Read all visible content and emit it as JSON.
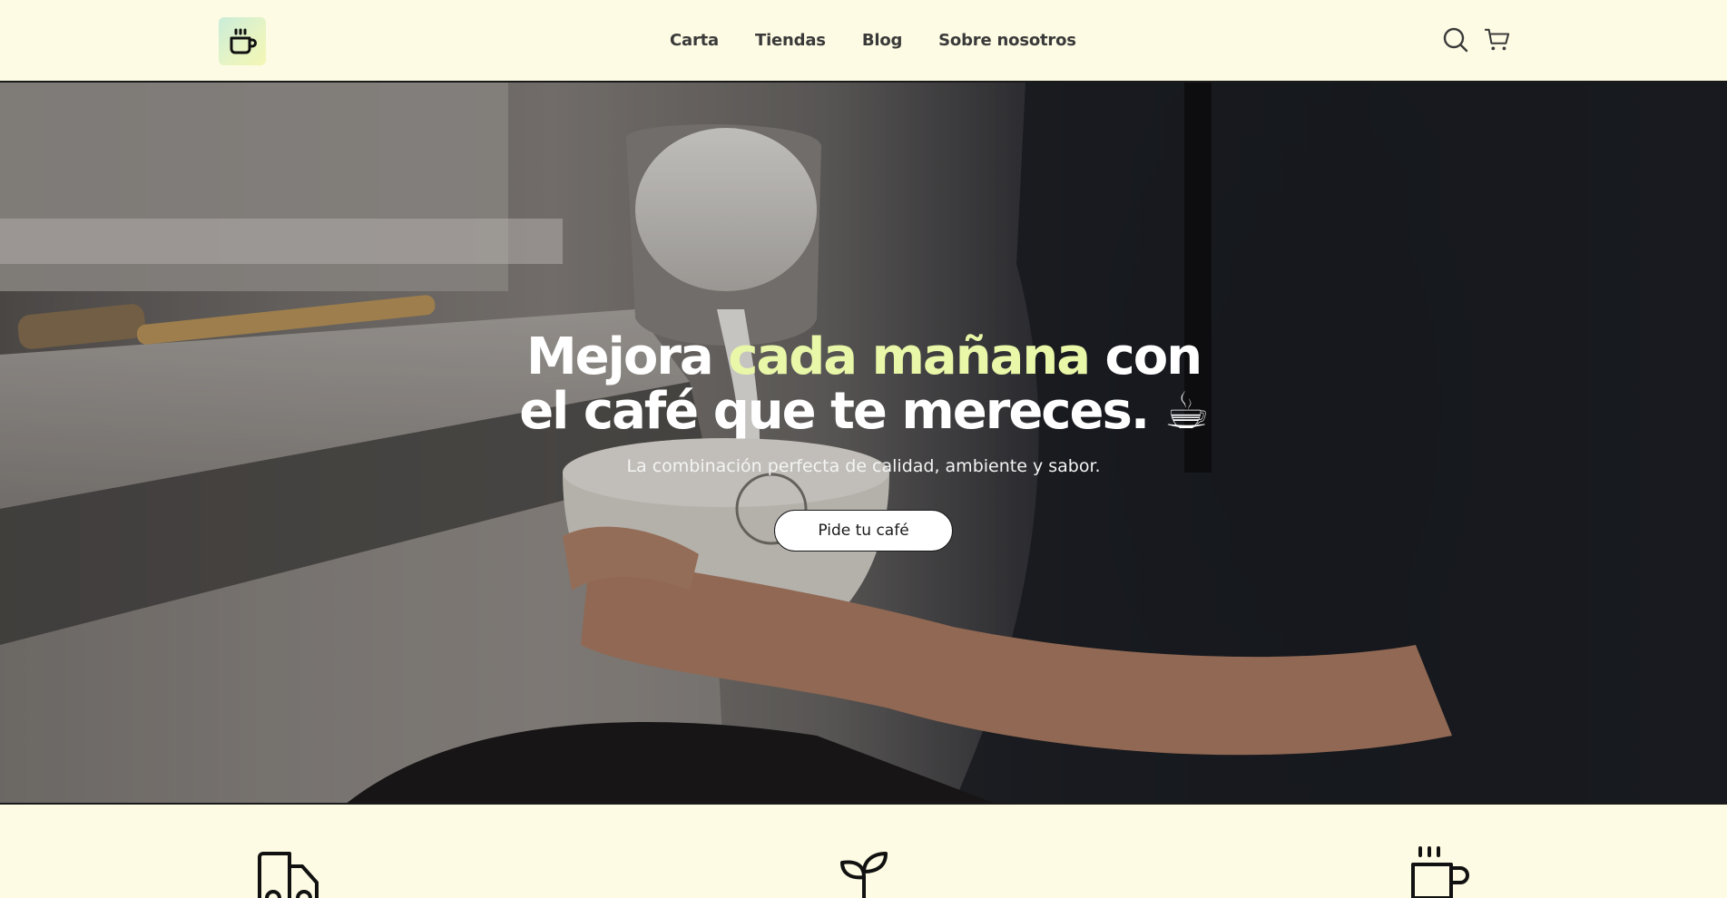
{
  "header": {
    "logo_icon": "coffee-mug-logo-icon",
    "nav": [
      {
        "label": "Carta"
      },
      {
        "label": "Tiendas"
      },
      {
        "label": "Blog"
      },
      {
        "label": "Sobre nosotros"
      }
    ],
    "search_icon": "search-icon",
    "cart_icon": "cart-icon"
  },
  "hero": {
    "title_part1": "Mejora ",
    "title_accent": "cada mañana",
    "title_part2": " con",
    "title_line2": "el café que te mereces. ☕",
    "subtitle": "La combinación perfecta de calidad, ambiente y sabor.",
    "cta_label": "Pide tu café"
  },
  "features": {
    "icons": [
      "delivery-truck-icon",
      "sprout-icon",
      "coffee-mug-icon"
    ]
  },
  "colors": {
    "background": "#fdfbe3",
    "accent": "#e8f7a8",
    "text_dark": "#3a3a3a"
  }
}
